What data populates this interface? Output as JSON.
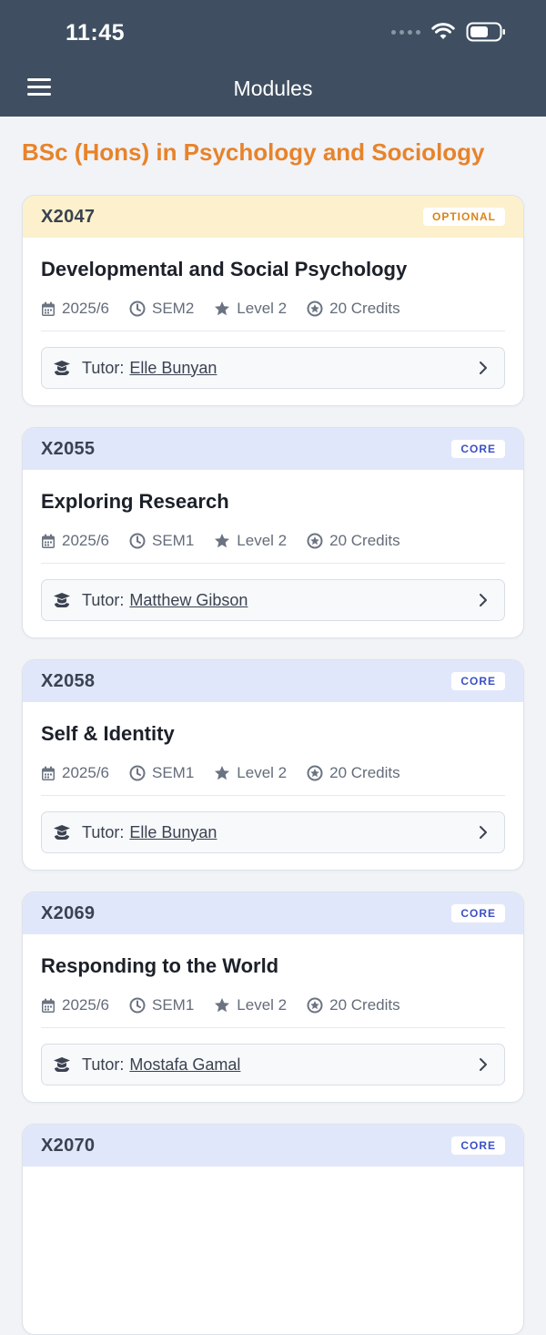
{
  "status": {
    "time": "11:45"
  },
  "nav": {
    "title": "Modules"
  },
  "program": {
    "title": "BSc (Hons) in Psychology and Sociology"
  },
  "tutor_label": "Tutor:",
  "modules": [
    {
      "code": "X2047",
      "type": "OPTIONAL",
      "name": "Developmental and Social Psychology",
      "year": "2025/6",
      "semester": "SEM2",
      "level": "Level 2",
      "credits": "20 Credits",
      "tutor": "Elle Bunyan"
    },
    {
      "code": "X2055",
      "type": "CORE",
      "name": "Exploring Research",
      "year": "2025/6",
      "semester": "SEM1",
      "level": "Level 2",
      "credits": "20 Credits",
      "tutor": "Matthew Gibson"
    },
    {
      "code": "X2058",
      "type": "CORE",
      "name": "Self & Identity",
      "year": "2025/6",
      "semester": "SEM1",
      "level": "Level 2",
      "credits": "20 Credits",
      "tutor": "Elle Bunyan"
    },
    {
      "code": "X2069",
      "type": "CORE",
      "name": "Responding to the World",
      "year": "2025/6",
      "semester": "SEM1",
      "level": "Level 2",
      "credits": "20 Credits",
      "tutor": "Mostafa Gamal"
    },
    {
      "code": "X2070",
      "type": "CORE"
    }
  ],
  "colors": {
    "header": "#3f4f61",
    "accent": "#e8832a",
    "optional_bg": "#fcf1cc",
    "core_bg": "#e1e7fb",
    "optional_text": "#d98414",
    "core_text": "#3b4fc6"
  },
  "icons": {
    "menu": "menu-icon",
    "wifi": "wifi-icon",
    "battery": "battery-icon",
    "calendar": "calendar-icon",
    "clock": "clock-icon",
    "star": "star-icon",
    "credits": "star-circle-icon",
    "tutor": "graduation-cap-icon",
    "chevron": "chevron-right-icon"
  }
}
